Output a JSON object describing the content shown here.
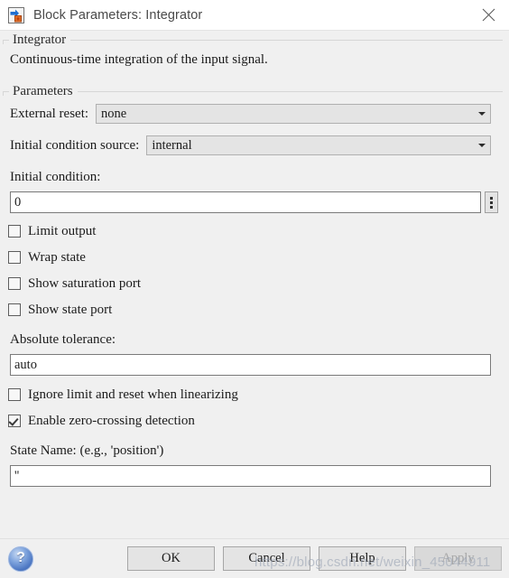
{
  "window": {
    "title": "Block Parameters: Integrator",
    "icon": "simulink-block-icon",
    "close_icon": "close-icon"
  },
  "description_group": {
    "legend": "Integrator",
    "text": "Continuous-time integration of the input signal."
  },
  "parameters_group": {
    "legend": "Parameters",
    "external_reset": {
      "label": "External reset:",
      "value": "none"
    },
    "initial_condition_source": {
      "label": "Initial condition source:",
      "value": "internal"
    },
    "initial_condition": {
      "label": "Initial condition:",
      "value": "0",
      "menu_icon": "kebab-menu-icon"
    },
    "checkboxes_upper": [
      {
        "label": "Limit output",
        "checked": false
      },
      {
        "label": "Wrap state",
        "checked": false
      },
      {
        "label": "Show saturation port",
        "checked": false
      },
      {
        "label": "Show state port",
        "checked": false
      }
    ],
    "absolute_tolerance": {
      "label": "Absolute tolerance:",
      "value": "auto"
    },
    "checkboxes_lower": [
      {
        "label": "Ignore limit and reset when linearizing",
        "checked": false
      },
      {
        "label": "Enable zero-crossing detection",
        "checked": true
      }
    ],
    "state_name": {
      "label": "State Name: (e.g., 'position')",
      "value": "''"
    }
  },
  "footer": {
    "help_icon": "help-question-icon",
    "buttons": [
      {
        "label": "OK",
        "disabled": false
      },
      {
        "label": "Cancel",
        "disabled": false
      },
      {
        "label": "Help",
        "disabled": false
      },
      {
        "label": "Apply",
        "disabled": true
      }
    ]
  },
  "watermark": {
    "text": "https://blog.csdn.net/weixin_45044911"
  }
}
